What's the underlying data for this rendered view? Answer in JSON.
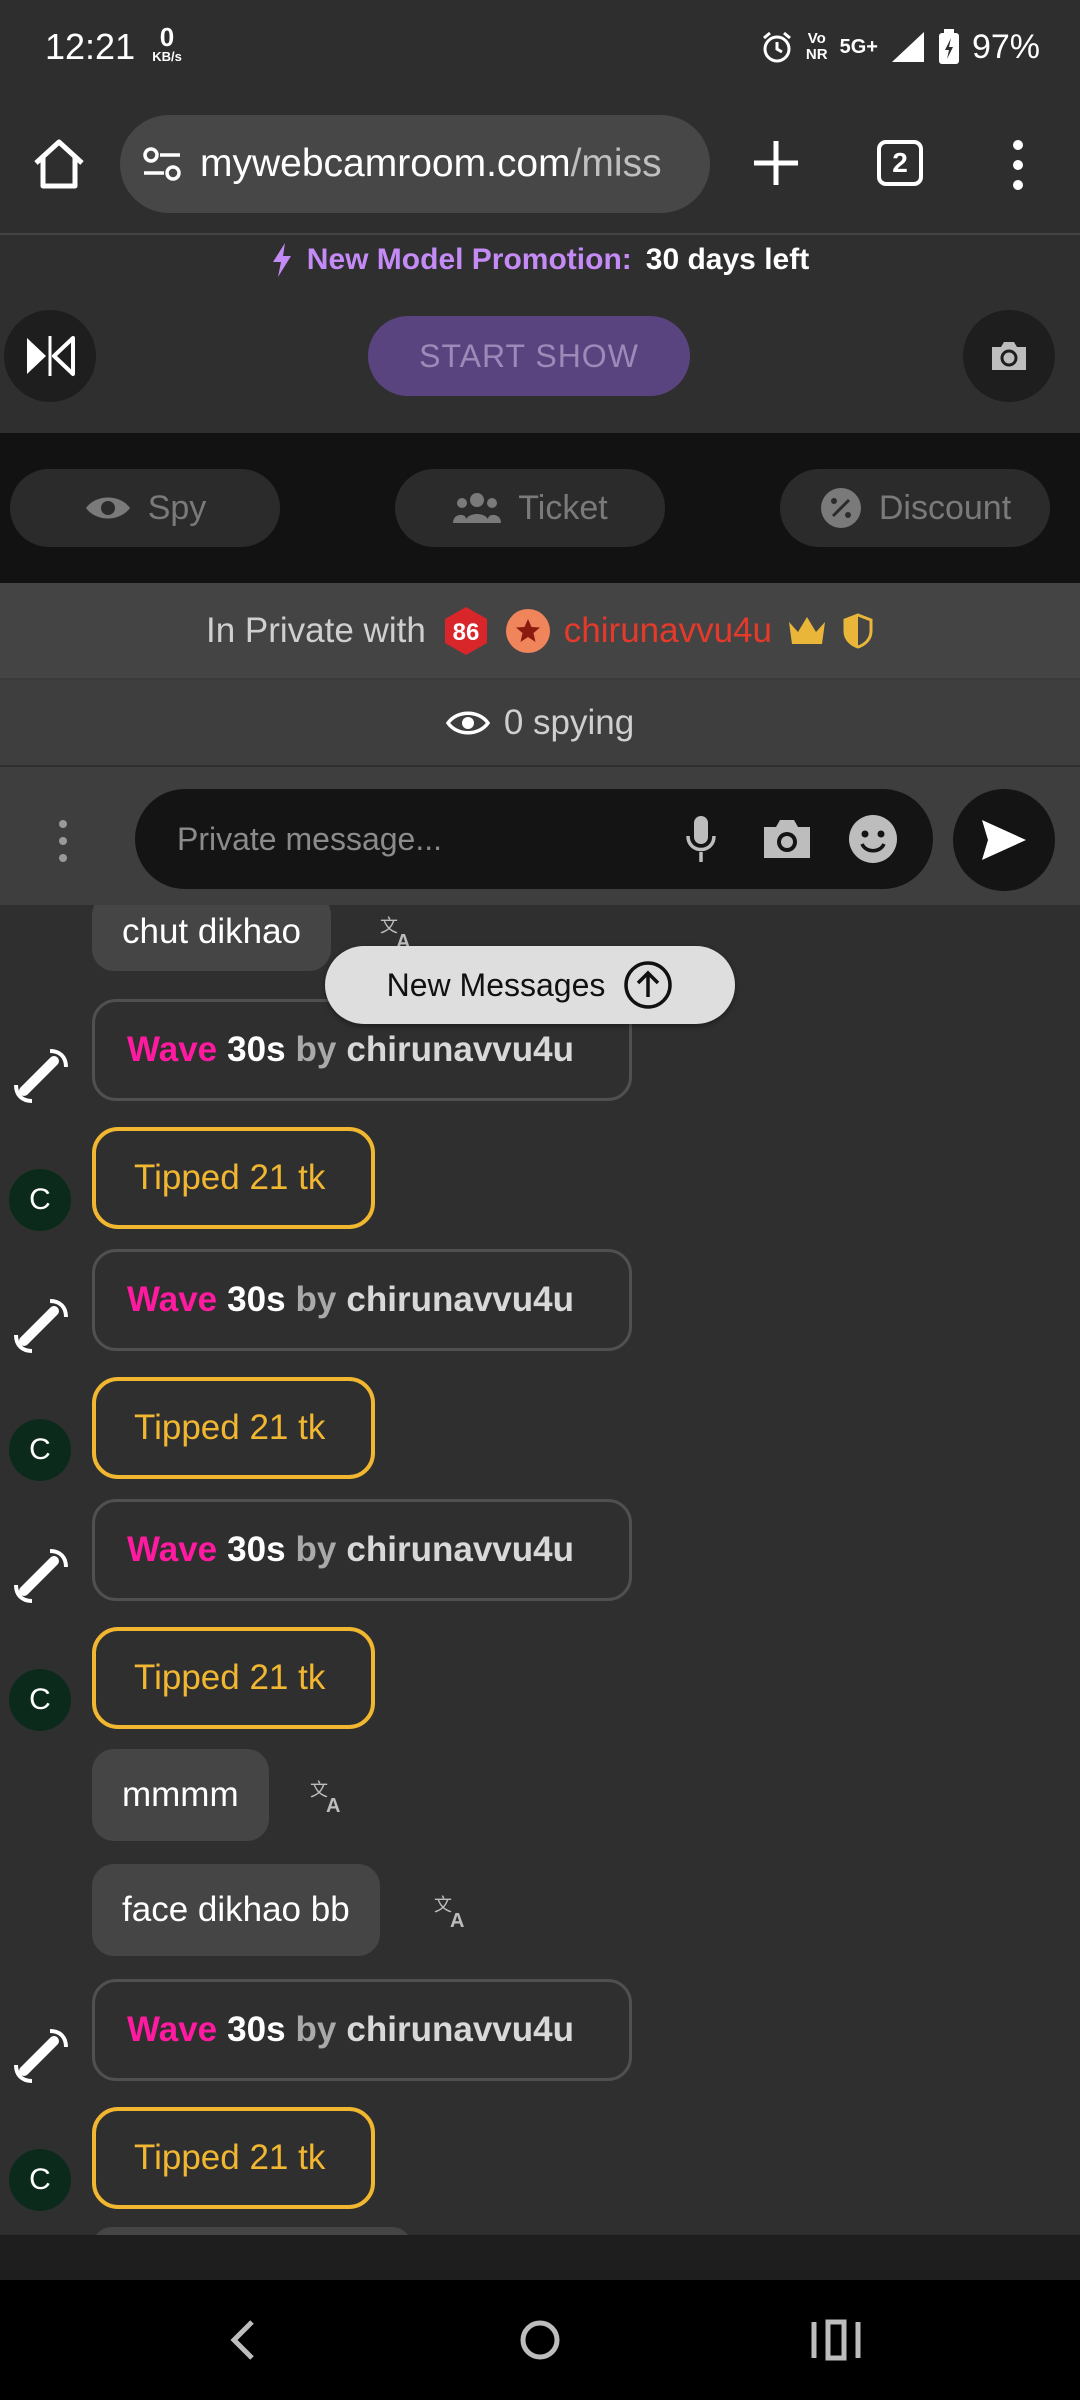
{
  "status_bar": {
    "time": "12:21",
    "kbs_value": "0",
    "kbs_unit": "KB/s",
    "net_top": "Vo",
    "net_bottom": "NR",
    "net_type": "5G+",
    "battery": "97%"
  },
  "browser": {
    "url_main": "mywebcamroom.com",
    "url_path": "/miss",
    "tab_count": "2"
  },
  "promo": {
    "label": "New Model Promotion:",
    "value": "30 days left"
  },
  "controls": {
    "start_show": "START SHOW"
  },
  "modes": {
    "spy": "Spy",
    "ticket": "Ticket",
    "discount": "Discount"
  },
  "private_bar": {
    "text": "In Private with",
    "level": "86",
    "username": "chirunavvu4u"
  },
  "spying": {
    "text": "0 spying"
  },
  "composer": {
    "placeholder": "Private message..."
  },
  "new_messages": {
    "label": "New Messages"
  },
  "chat": {
    "messages": [
      {
        "type": "text",
        "text": "chut dikhao"
      },
      {
        "type": "wave",
        "wave": "Wave",
        "duration": "30s",
        "by": "by",
        "user": "chirunavvu4u"
      },
      {
        "type": "tip",
        "avatar": "C",
        "text": "Tipped 21 tk"
      },
      {
        "type": "wave",
        "wave": "Wave",
        "duration": "30s",
        "by": "by",
        "user": "chirunavvu4u"
      },
      {
        "type": "tip",
        "avatar": "C",
        "text": "Tipped 21 tk"
      },
      {
        "type": "wave",
        "wave": "Wave",
        "duration": "30s",
        "by": "by",
        "user": "chirunavvu4u"
      },
      {
        "type": "tip",
        "avatar": "C",
        "text": "Tipped 21 tk"
      },
      {
        "type": "text",
        "text": "mmmm"
      },
      {
        "type": "text",
        "text": "face dikhao bb"
      },
      {
        "type": "wave",
        "wave": "Wave",
        "duration": "30s",
        "by": "by",
        "user": "chirunavvu4u"
      },
      {
        "type": "tip",
        "avatar": "C",
        "text": "Tipped 21 tk"
      }
    ]
  },
  "colors": {
    "accent_purple": "#c48af5",
    "wave_pink": "#ff1aa0",
    "tip_gold": "#f2b731",
    "username_red": "#e53a2a"
  }
}
